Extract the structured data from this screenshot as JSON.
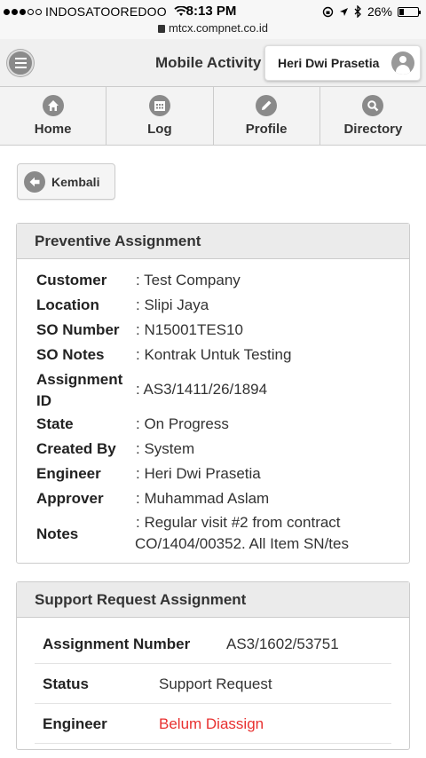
{
  "status_bar": {
    "carrier": "INDOSATOOREDOO",
    "time": "8:13 PM",
    "battery": "26%",
    "battery_level": 0.26,
    "url": "mtcx.compnet.co.id"
  },
  "header": {
    "title": "Mobile Activity",
    "user_name": "Heri Dwi Prasetia"
  },
  "nav": [
    {
      "label": "Home",
      "icon": "home-icon"
    },
    {
      "label": "Log",
      "icon": "calendar-icon"
    },
    {
      "label": "Profile",
      "icon": "pencil-icon"
    },
    {
      "label": "Directory",
      "icon": "search-icon"
    }
  ],
  "back_label": "Kembali",
  "preventive": {
    "title": "Preventive Assignment",
    "customer_label": "Customer",
    "customer": ": Test Company",
    "location_label": "Location",
    "location": ": Slipi Jaya",
    "so_number_label": "SO Number",
    "so_number": ": N15001TES10",
    "so_notes_label": "SO Notes",
    "so_notes": ": Kontrak Untuk Testing",
    "assignment_id_label_1": "Assignment",
    "assignment_id_label_2": "ID",
    "assignment_id": ": AS3/1411/26/1894",
    "state_label": "State",
    "state": ": On Progress",
    "created_by_label": "Created By",
    "created_by": ": System",
    "engineer_label": "Engineer",
    "engineer": ": Heri Dwi Prasetia",
    "approver_label": "Approver",
    "approver": ": Muhammad Aslam",
    "notes_label": "Notes",
    "notes_1": ": Regular visit #2 from contract",
    "notes_2": "CO/1404/00352. All Item SN/tes"
  },
  "support": {
    "title": "Support Request Assignment",
    "assignment_number_label": "Assignment Number",
    "assignment_number": "AS3/1602/53751",
    "status_label": "Status",
    "status": "Support Request",
    "engineer_label": "Engineer",
    "engineer": "Belum Diassign"
  },
  "colors": {
    "unassigned": "#e8302f",
    "icon_gray": "#8a8a8a"
  }
}
